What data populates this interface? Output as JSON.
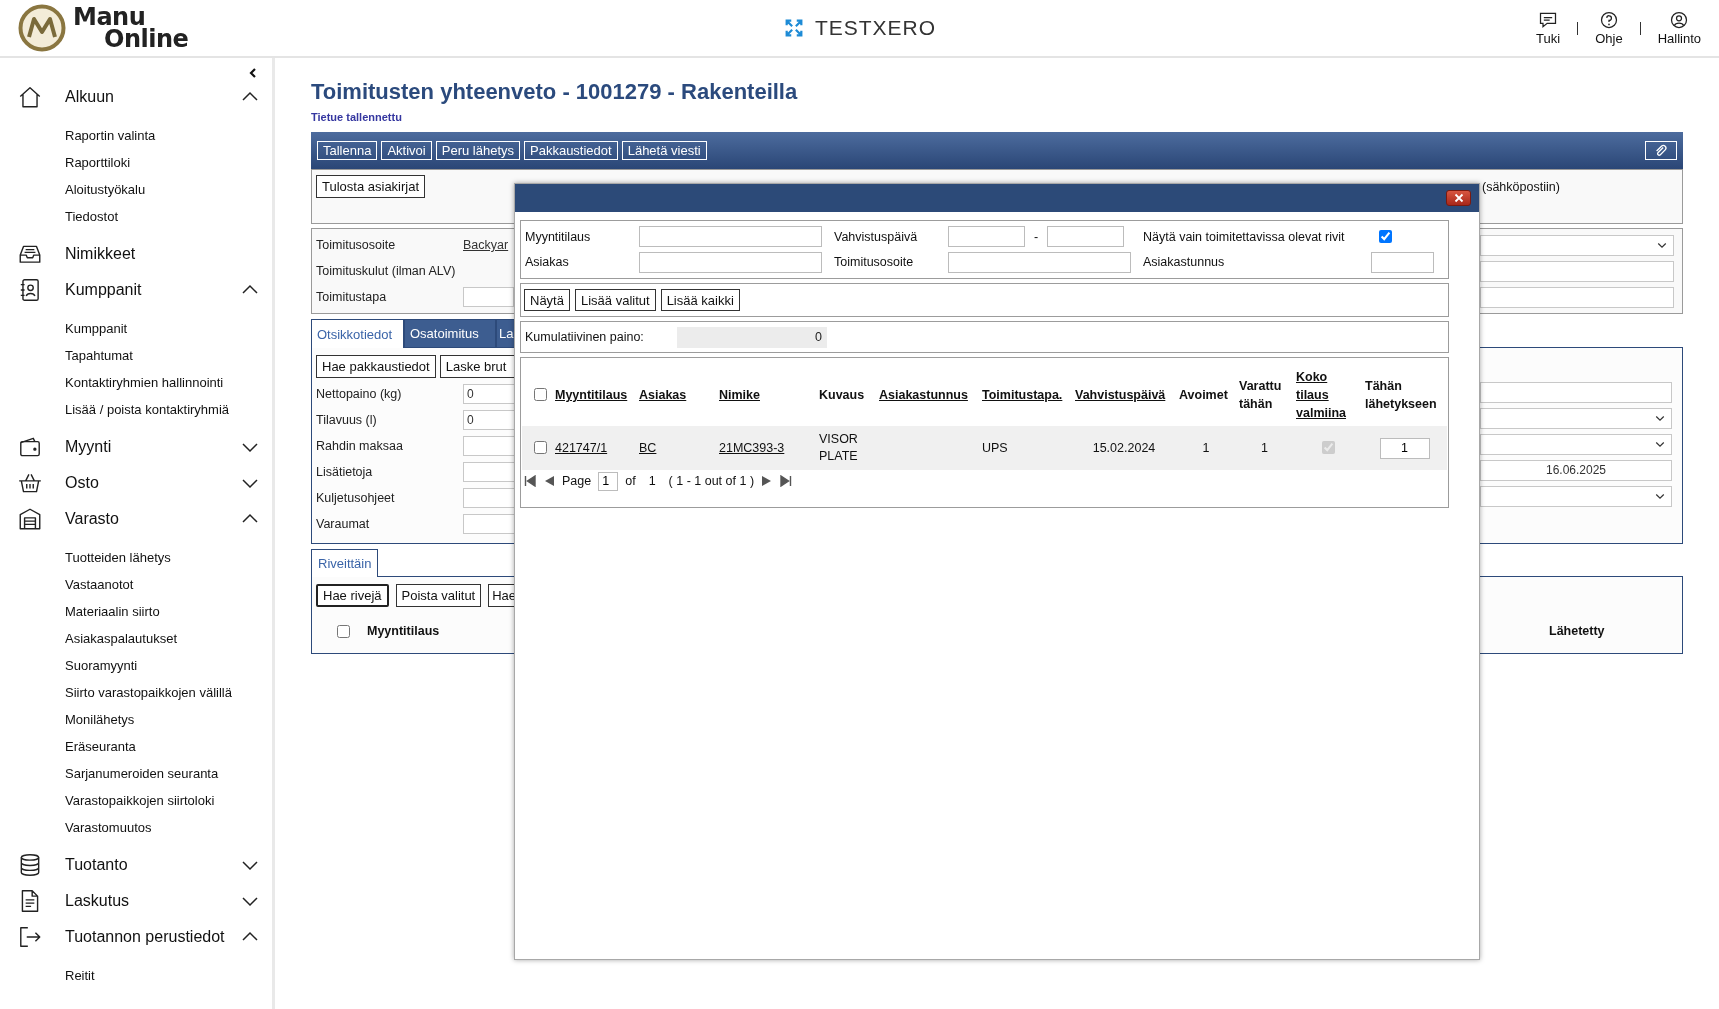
{
  "header": {
    "logo": [
      "Manu",
      "Online"
    ],
    "environment": "TESTXERO",
    "actions": [
      {
        "label": "Tuki"
      },
      {
        "label": "Ohje"
      },
      {
        "label": "Hallinto"
      }
    ]
  },
  "sidebar": {
    "groups": [
      {
        "label": "Alkuun",
        "kind": "group",
        "expanded": true,
        "children": [
          {
            "label": "Raportin valinta"
          },
          {
            "label": "Raporttiloki"
          },
          {
            "label": "Aloitustyökalu"
          },
          {
            "label": "Tiedostot"
          }
        ]
      },
      {
        "label": "Nimikkeet",
        "kind": "link"
      },
      {
        "label": "Kumppanit",
        "kind": "group",
        "expanded": true,
        "children": [
          {
            "label": "Kumppanit"
          },
          {
            "label": "Tapahtumat"
          },
          {
            "label": "Kontaktiryhmien hallinnointi"
          },
          {
            "label": "Lisää / poista kontaktiryhmiä"
          }
        ]
      },
      {
        "label": "Myynti",
        "kind": "group",
        "expanded": false
      },
      {
        "label": "Osto",
        "kind": "group",
        "expanded": false
      },
      {
        "label": "Varasto",
        "kind": "group",
        "expanded": true,
        "children": [
          {
            "label": "Tuotteiden lähetys"
          },
          {
            "label": "Vastaanotot"
          },
          {
            "label": "Materiaalin siirto"
          },
          {
            "label": "Asiakaspalautukset"
          },
          {
            "label": "Suoramyynti"
          },
          {
            "label": "Siirto varastopaikkojen välillä"
          },
          {
            "label": "Monilähetys"
          },
          {
            "label": "Eräseuranta"
          },
          {
            "label": "Sarjanumeroiden seuranta"
          },
          {
            "label": "Varastopaikkojen siirtoloki"
          },
          {
            "label": "Varastomuutos"
          }
        ]
      },
      {
        "label": "Tuotanto",
        "kind": "group",
        "expanded": false
      },
      {
        "label": "Laskutus",
        "kind": "group",
        "expanded": false
      },
      {
        "label": "Tuotannon perustiedot",
        "kind": "group",
        "expanded": true,
        "children": [
          {
            "label": "Reitit"
          }
        ]
      }
    ]
  },
  "page": {
    "title": "Toimitusten yhteenveto - 1001279 - Rakenteilla",
    "status": "Tietue tallennettu"
  },
  "toolbar": {
    "buttons": [
      "Tallenna",
      "Aktivoi",
      "Peru lähetys",
      "Pakkaustiedot",
      "Lähetä viesti"
    ]
  },
  "print_panel": {
    "button": "Tulosta asiakirjat",
    "email_note": "(sähköpostiin)"
  },
  "delivery_panel": {
    "fields": [
      {
        "label": "Toimitusosoite",
        "kind": "link",
        "value": "Backyar"
      },
      {
        "label": "Toimituskulut (ilman ALV)",
        "kind": "text"
      },
      {
        "label": "Toimitustapa",
        "kind": "input"
      }
    ],
    "right_fields": [
      {
        "kind": "select"
      },
      {
        "kind": "input"
      },
      {
        "kind": "input"
      }
    ]
  },
  "header_panel": {
    "tabs": [
      {
        "label": "Otsikkotiedot",
        "selected": true
      },
      {
        "label": "Osatoimitus",
        "selected": false
      },
      {
        "label": "La",
        "selected": false
      }
    ],
    "buttons": [
      "Hae pakkaustiedot",
      "Laske brut"
    ],
    "fields": [
      {
        "label": "Nettopaino (kg)",
        "value": "0"
      },
      {
        "label": "Tilavuus (l)",
        "value": "0"
      },
      {
        "label": "Rahdin maksaa"
      },
      {
        "label": "Lisätietoja"
      },
      {
        "label": "Kuljetusohjeet"
      },
      {
        "label": "Varaumat"
      }
    ],
    "right_fields": [
      {
        "kind": "input"
      },
      {
        "kind": "select"
      },
      {
        "kind": "select"
      },
      {
        "kind": "input",
        "value": "16.06.2025"
      },
      {
        "kind": "select"
      }
    ]
  },
  "rows_panel": {
    "tabs": [
      {
        "label": "Riveittäin",
        "selected": true
      }
    ],
    "buttons": [
      {
        "label": "Hae rivejä",
        "focused": true
      },
      {
        "label": "Poista valitut",
        "focused": false
      },
      {
        "label": "Hae",
        "focused": false
      }
    ],
    "select_all_checked": false,
    "columns": [
      "Myyntitilaus",
      "Lähetetty"
    ]
  },
  "dialog": {
    "filters": [
      {
        "label": "Myyntitilaus",
        "kind": "text"
      },
      {
        "label": "Vahvistuspäivä",
        "kind": "range",
        "separator": "-"
      },
      {
        "label": "Näytä vain toimitettavissa olevat rivit",
        "kind": "checkbox",
        "checked": true
      },
      {
        "label": "Asiakas",
        "kind": "text"
      },
      {
        "label": "Toimitusosoite",
        "kind": "text"
      },
      {
        "label": "Asiakastunnus",
        "kind": "short"
      }
    ],
    "buttons": [
      "Näytä",
      "Lisää valitut",
      "Lisää kaikki"
    ],
    "weight": {
      "label": "Kumulatiivinen paino:",
      "value": "0"
    },
    "select_all_checked": false,
    "columns": [
      {
        "label": "Myyntitilaus",
        "sortable": true
      },
      {
        "label": "Asiakas",
        "sortable": true
      },
      {
        "label": "Nimike",
        "sortable": true
      },
      {
        "label": "Kuvaus",
        "sortable": false
      },
      {
        "label": "Asiakastunnus",
        "sortable": true
      },
      {
        "label": "Toimitustapa.",
        "sortable": true
      },
      {
        "label": "Vahvistuspäivä",
        "sortable": true
      },
      {
        "label": "Avoimet",
        "sortable": false
      },
      {
        "label": "Varattu tähän",
        "sortable": false
      },
      {
        "label": "Koko tilaus valmiina",
        "sortable": true
      },
      {
        "label": "Tähän lähetykseen",
        "sortable": false
      }
    ],
    "rows": [
      {
        "selected": false,
        "order": "421747/1",
        "customer": "BC",
        "item": "21MC393-3",
        "description": "VISOR PLATE",
        "method": "UPS",
        "date": "15.02.2024",
        "open": "1",
        "reserved": "1",
        "complete": true,
        "quantity": "1"
      }
    ],
    "pager": {
      "page_label": "Page",
      "page": "1",
      "of_label": "of",
      "pages": "1",
      "summary": "( 1 - 1 out of 1 )"
    }
  }
}
